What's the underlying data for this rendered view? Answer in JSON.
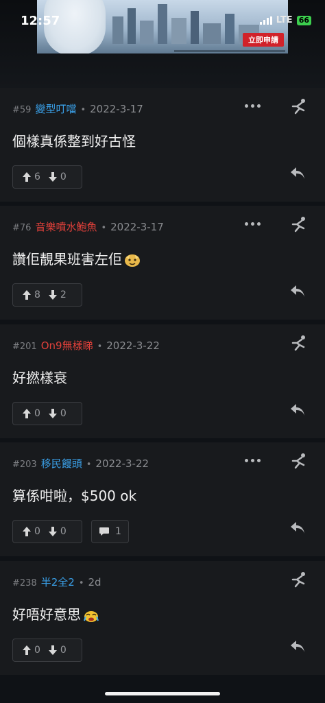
{
  "status": {
    "time": "12:57",
    "network": "LTE",
    "battery": "66"
  },
  "ad": {
    "cta_label": "立即申請"
  },
  "posts": [
    {
      "num": "#59",
      "user": "變型叮噹",
      "user_color": "#3aa0e8",
      "sep": "•",
      "date": "2022-3-17",
      "body": "個樣真係整到好古怪",
      "up": "6",
      "down": "0",
      "reply_count": null
    },
    {
      "num": "#76",
      "user": "音樂噴水鮑魚",
      "user_color": "#e0403a",
      "sep": "•",
      "date": "2022-3-17",
      "body": "讚佢靚果班害左佢",
      "up": "8",
      "down": "2",
      "reply_count": null,
      "emoji": "sticker-icon"
    },
    {
      "num": "#201",
      "user": "On9無樣睇",
      "user_color": "#e0403a",
      "sep": "•",
      "date": "2022-3-22",
      "body": "好撚樣衰",
      "up": "0",
      "down": "0",
      "reply_count": null
    },
    {
      "num": "#203",
      "user": "移民饅頭",
      "user_color": "#3aa0e8",
      "sep": "•",
      "date": "2022-3-22",
      "body": "算係咁啦，$500 ok",
      "up": "0",
      "down": "0",
      "reply_count": "1"
    },
    {
      "num": "#238",
      "user": "半2全2",
      "user_color": "#3aa0e8",
      "sep": "•",
      "date": "2d",
      "body": "好唔好意思",
      "up": "0",
      "down": "0",
      "reply_count": null,
      "emoji": "crying-sticker-icon"
    }
  ]
}
